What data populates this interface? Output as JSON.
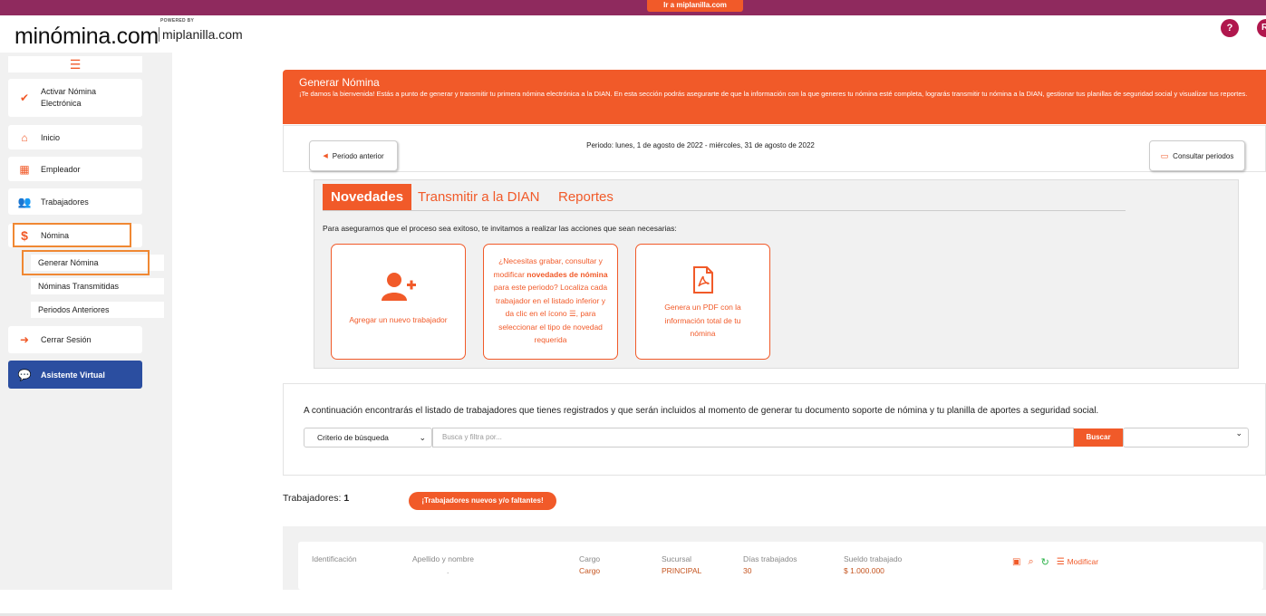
{
  "topbar": {
    "link_label": "Ir a miplanilla.com"
  },
  "logo": {
    "main": "minómina.com",
    "powered": "POWERED BY",
    "sub": "miplanilla.com"
  },
  "header": {
    "help_icon": "question-icon",
    "user_initial": "R"
  },
  "sidebar": {
    "items": [
      {
        "label": "Activar Nómina Electrónica",
        "icon": "check-icon"
      },
      {
        "label": "Inicio",
        "icon": "home-icon"
      },
      {
        "label": "Empleador",
        "icon": "building-icon"
      },
      {
        "label": "Trabajadores",
        "icon": "users-icon"
      },
      {
        "label": "Nómina",
        "icon": "dollar-icon"
      },
      {
        "label": "Cerrar Sesión",
        "icon": "logout-icon"
      }
    ],
    "subitems": [
      {
        "label": "Generar Nómina"
      },
      {
        "label": "Nóminas Transmitidas"
      },
      {
        "label": "Periodos Anteriores"
      }
    ],
    "assistant": "Asistente Virtual"
  },
  "banner": {
    "title": "Generar Nómina",
    "text": "¡Te damos la bienvenida! Estás a punto de generar y transmitir tu primera nómina electrónica a la DIAN. En esta sección podrás asegurarte de que la información con la que generes tu nómina esté completa, lograrás transmitir tu nómina a la DIAN, gestionar tus planillas de seguridad social y visualizar tus reportes."
  },
  "period": {
    "prev_label": "Periodo anterior",
    "text": "Periodo: lunes, 1 de agosto de 2022 - miércoles, 31 de agosto de 2022",
    "consult_label": "Consultar periodos"
  },
  "tabs": [
    "Novedades",
    "Transmitir a la DIAN",
    "Reportes"
  ],
  "panel": {
    "intro": "Para asegurarnos que el proceso sea exitoso, te invitamos a realizar las acciones que sean necesarias:",
    "card1": "Agregar un nuevo trabajador",
    "card2_a": "¿Necesitas grabar, consultar y modificar ",
    "card2_b": "novedades de nómina",
    "card2_c": " para este periodo? Localiza cada trabajador en el listado inferior y da clic en el ícono ",
    "card2_d": ", para seleccionar el tipo de novedad requerida",
    "card3": "Genera un PDF con la información total de tu nómina"
  },
  "list": {
    "intro": "A continuación encontrarás el listado de trabajadores que tienes registrados y que serán incluidos al momento de generar tu documento soporte de nómina y tu planilla de aportes a seguridad social.",
    "criteria": "Criterio de búsqueda",
    "search_placeholder": "Busca y filtra por...",
    "search_btn": "Buscar"
  },
  "workers": {
    "title": "Trabajadores:",
    "count": "1",
    "new_btn": "¡Trabajadores nuevos y/o faltantes!"
  },
  "table": {
    "headers": [
      "Identificación",
      "Apellido y nombre",
      "Cargo",
      "Sucursal",
      "Días trabajados",
      "Sueldo trabajado"
    ],
    "row": {
      "id": "",
      "name": ".",
      "cargo": "Cargo",
      "sucursal": "PRINCIPAL",
      "dias": "30",
      "sueldo": "$ 1.000.000"
    },
    "modify": "Modificar"
  },
  "colors": {
    "accent": "#f15a29",
    "topbar": "#8f2a5e",
    "assistant": "#2b4ea0"
  }
}
